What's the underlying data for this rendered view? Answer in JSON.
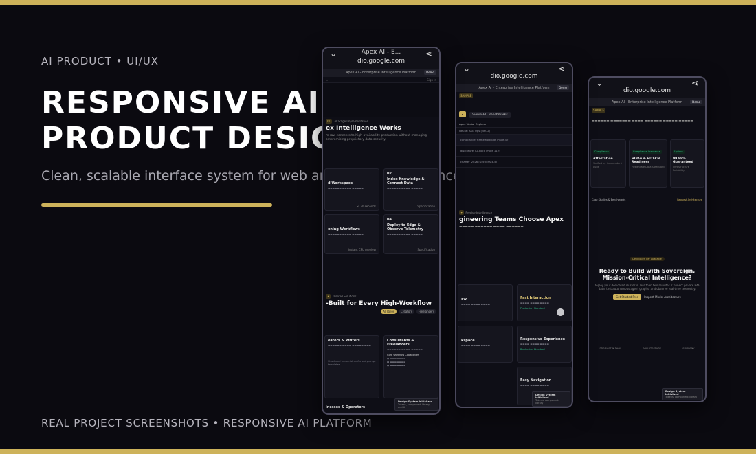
{
  "hero": {
    "eyebrow": "AI PRODUCT • UI/UX",
    "title_line1": "RESPONSIVE AI",
    "title_line2": "PRODUCT DESIGN",
    "subtitle": "Clean, scalable interface system for web and mobile experiences",
    "footer": "REAL PROJECT SCREENSHOTS • RESPONSIVE AI PLATFORM"
  },
  "colors": {
    "accent": "#cdb25a",
    "background": "#0b0a10"
  },
  "browser": {
    "tab_title": "Apex AI - E...",
    "url": "dio.google.com",
    "site_title": "Apex AI - Enterprise Intelligence Platform",
    "demo_button": "Demo",
    "sign_in": "Sign In"
  },
  "phone1": {
    "section_tag": "01",
    "section_label": "AI Stage Implementation",
    "heading": "ex Intelligence Works",
    "desc": "m raw concepts to high-availability production without managing ompromising proprietary data security.",
    "cards": [
      {
        "title": "d Workspace",
        "num": "",
        "meta": "< 30 seconds"
      },
      {
        "title": "Index Knowledge & Connect Data",
        "num": "02",
        "meta": "Specification"
      },
      {
        "title": "oning Workflows",
        "num": "",
        "meta": "Instant CPU preview"
      },
      {
        "title": "Deploy to Edge & Observe Telemetry",
        "num": "04",
        "meta": "Specification"
      }
    ],
    "section2_label": "Tailored Solutions",
    "heading2": "-Built for Every High-Workflow",
    "pills": [
      "All Roles",
      "Creators",
      "Freelancers"
    ],
    "card_a_title": "eators & Writers",
    "card_b_title": "Consultants & Freelancers",
    "card_b_sub": "Core Workflow Capabilities",
    "card_a_foot": "Structured transcript drafts and prompt templates",
    "toast_title": "Design System Initialized",
    "toast_sub": "Tokens, component library, and UI",
    "bottom_label": "inesses & Operators"
  },
  "phone2": {
    "section_label": "SAMPLE",
    "benchmarks_btn": "View R&D Benchmarks",
    "explorer_label": "Apex Vector Explorer",
    "rows": [
      "Neural RAG Ops (NPO2)",
      "_compliance_framework.pdf (Page 42)",
      "_disclosure_v2.docx (Page 112)",
      "_charter_2026 (Sections 4-5)"
    ],
    "heading": "gineering Teams Choose Apex",
    "section_tag": "Precise Intelligence",
    "cards": [
      {
        "title": "ow",
        "meta": "Fast Interaction"
      },
      {
        "title": "Fast Interaction",
        "meta": "Production Standard"
      },
      {
        "title": "kspace",
        "meta": ""
      },
      {
        "title": "Responsive Experience",
        "meta": "Production Standard"
      },
      {
        "title": "Easy Navigation",
        "meta": ""
      }
    ],
    "toast_title": "Design System Initialized",
    "toast_sub": "Tokens, component library"
  },
  "phone3": {
    "section_label": "SAMPLE",
    "stat_cards": [
      {
        "label": "Compliance",
        "title": "Attestation",
        "sub": "Verified by independent audit"
      },
      {
        "label": "Compliance Assurance",
        "title": "HIPAA & HITECH Readiness",
        "sub": "Healthcare Data Safeguard"
      },
      {
        "label": "Uptime",
        "title": "99.99% Guaranteed",
        "sub": "Infrastructure Reliability"
      }
    ],
    "link_left": "Case Studies & Benchmarks",
    "link_right": "Request Architecture",
    "cta_tag": "Developer Tier Available",
    "cta_heading": "Ready to Build with Sovereign, Mission-Critical Intelligence?",
    "cta_desc": "Deploy your dedicated cluster in less than two minutes. Connect private RAG data, test autonomous agent graphs, and observe real-time telemetry.",
    "cta_primary": "Get Started Free",
    "cta_secondary": "Inspect Model Architecture",
    "footer_cols": [
      "PRODUCT & RAGS",
      "ARCHITECTURE",
      "COMPANY"
    ],
    "toast_title": "Design System Initialized",
    "toast_sub": "Tokens, component library"
  }
}
